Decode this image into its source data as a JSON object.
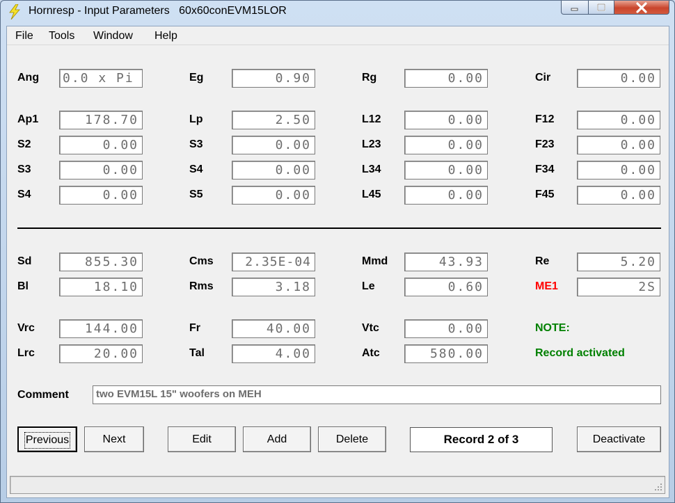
{
  "window": {
    "title": "Hornresp - Input Parameters   60x60conEVM15LOR"
  },
  "menu": [
    "File",
    "Tools",
    "Window",
    "Help"
  ],
  "rows": {
    "r1": [
      {
        "label": "Ang",
        "value": "0.0 x Pi"
      },
      {
        "label": "Eg",
        "value": "0.90"
      },
      {
        "label": "Rg",
        "value": "0.00"
      },
      {
        "label": "Cir",
        "value": "0.00"
      }
    ],
    "r2": [
      {
        "label": "Ap1",
        "value": "178.70"
      },
      {
        "label": "Lp",
        "value": "2.50"
      },
      {
        "label": "L12",
        "value": "0.00"
      },
      {
        "label": "F12",
        "value": "0.00"
      }
    ],
    "r3": [
      {
        "label": "S2",
        "value": "0.00"
      },
      {
        "label": "S3",
        "value": "0.00"
      },
      {
        "label": "L23",
        "value": "0.00"
      },
      {
        "label": "F23",
        "value": "0.00"
      }
    ],
    "r4": [
      {
        "label": "S3",
        "value": "0.00"
      },
      {
        "label": "S4",
        "value": "0.00"
      },
      {
        "label": "L34",
        "value": "0.00"
      },
      {
        "label": "F34",
        "value": "0.00"
      }
    ],
    "r5": [
      {
        "label": "S4",
        "value": "0.00"
      },
      {
        "label": "S5",
        "value": "0.00"
      },
      {
        "label": "L45",
        "value": "0.00"
      },
      {
        "label": "F45",
        "value": "0.00"
      }
    ],
    "r6": [
      {
        "label": "Sd",
        "value": "855.30"
      },
      {
        "label": "Cms",
        "value": "2.35E-04"
      },
      {
        "label": "Mmd",
        "value": "43.93"
      },
      {
        "label": "Re",
        "value": "5.20"
      }
    ],
    "r7": [
      {
        "label": "Bl",
        "value": "18.10"
      },
      {
        "label": "Rms",
        "value": "3.18"
      },
      {
        "label": "Le",
        "value": "0.60"
      },
      {
        "label": "ME1",
        "value": "2S"
      }
    ],
    "r8": [
      {
        "label": "Vrc",
        "value": "144.00"
      },
      {
        "label": "Fr",
        "value": "40.00"
      },
      {
        "label": "Vtc",
        "value": "0.00"
      }
    ],
    "r9": [
      {
        "label": "Lrc",
        "value": "20.00"
      },
      {
        "label": "Tal",
        "value": "4.00"
      },
      {
        "label": "Atc",
        "value": "580.00"
      }
    ]
  },
  "note": {
    "title": "NOTE:",
    "text": "Record activated"
  },
  "comment": {
    "label": "Comment",
    "value": "two EVM15L 15\" woofers on MEH"
  },
  "buttons": {
    "previous": "Previous",
    "next": "Next",
    "edit": "Edit",
    "add": "Add",
    "delete": "Delete",
    "deactivate": "Deactivate"
  },
  "record": "Record 2 of 3",
  "colors": {
    "me1_label": "#ff0000",
    "note": "#008000"
  }
}
